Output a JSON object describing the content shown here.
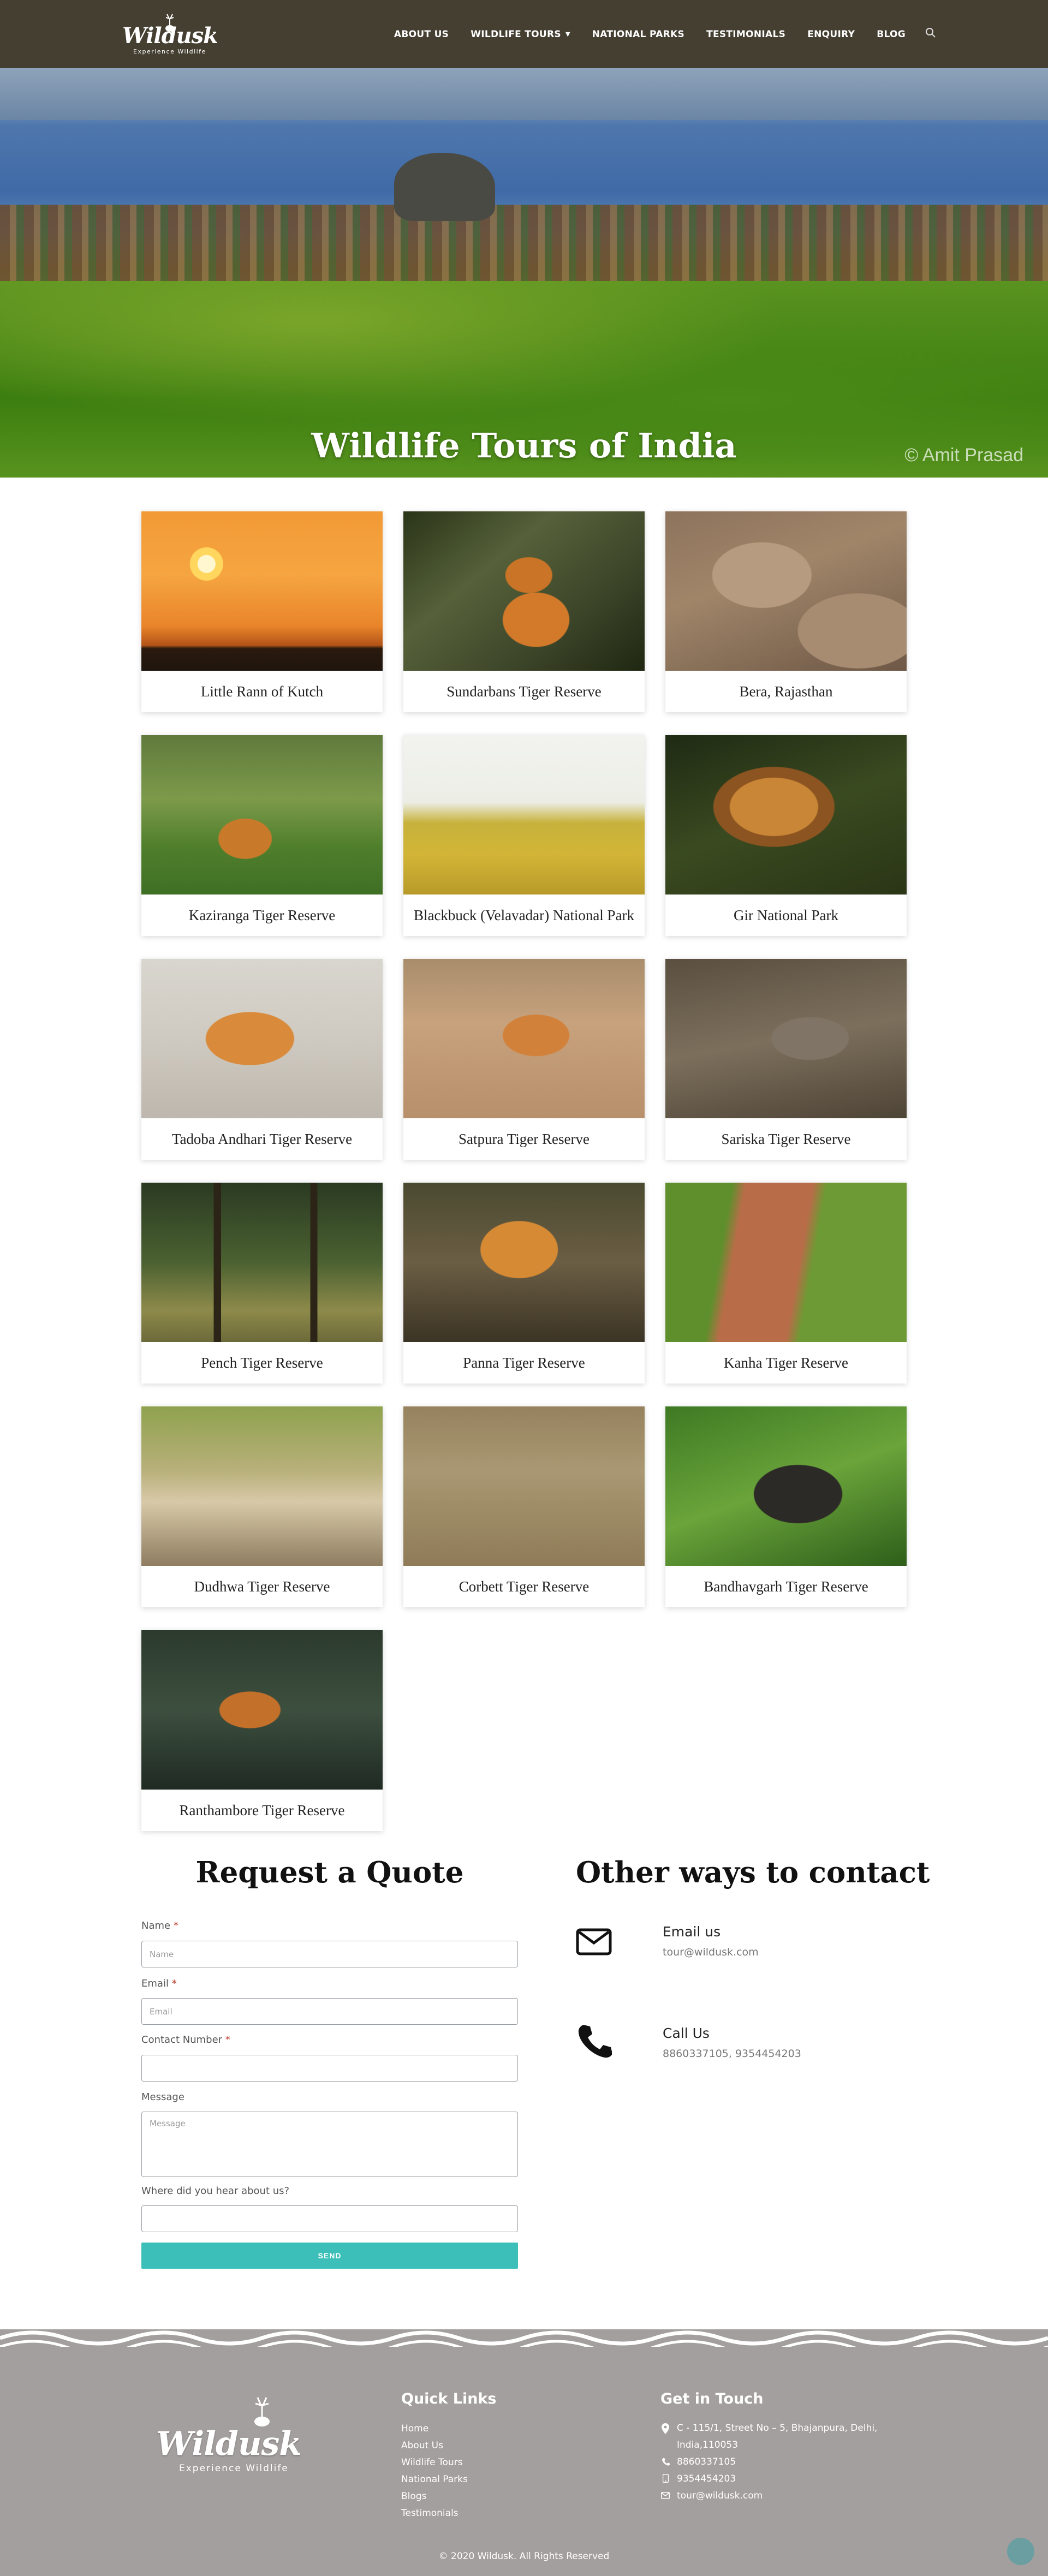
{
  "brand": {
    "logo_text": "Wildusk",
    "logo_sub": "Experience Wildlife"
  },
  "nav": {
    "items": [
      "ABOUT US",
      "WILDLIFE TOURS",
      "NATIONAL PARKS",
      "TESTIMONIALS",
      "ENQUIRY",
      "BLOG"
    ],
    "search_icon": "search-icon"
  },
  "hero": {
    "title": "Wildlife Tours of India",
    "credit": "© Amit Prasad"
  },
  "tours": [
    {
      "name": "Little Rann of Kutch",
      "img": "sunset"
    },
    {
      "name": "Sundarbans Tiger Reserve",
      "img": "tiger-forest"
    },
    {
      "name": "Bera, Rajasthan",
      "img": "rocks"
    },
    {
      "name": "Kaziranga Tiger Reserve",
      "img": "tiger-grass"
    },
    {
      "name": "Blackbuck (Velavadar) National Park",
      "img": "blackbuck"
    },
    {
      "name": "Gir National Park",
      "img": "lion"
    },
    {
      "name": "Tadoba Andhari Tiger Reserve",
      "img": "tiger-light"
    },
    {
      "name": "Satpura Tiger Reserve",
      "img": "tiger-road"
    },
    {
      "name": "Sariska Tiger Reserve",
      "img": "hyena"
    },
    {
      "name": "Pench Tiger Reserve",
      "img": "forest-dark"
    },
    {
      "name": "Panna Tiger Reserve",
      "img": "tiger-rocks"
    },
    {
      "name": "Kanha Tiger Reserve",
      "img": "tiger-path"
    },
    {
      "name": "Dudhwa Tiger Reserve",
      "img": "tiger-resting"
    },
    {
      "name": "Corbett Tiger Reserve",
      "img": "tiger-cubs"
    },
    {
      "name": "Bandhavgarh Tiger Reserve",
      "img": "gaur"
    },
    {
      "name": "Ranthambore Tiger Reserve",
      "img": "tiger-water"
    }
  ],
  "quote": {
    "title": "Request a Quote",
    "name_label": "Name",
    "name_placeholder": "Name",
    "email_label": "Email",
    "email_placeholder": "Email",
    "contact_label": "Contact Number",
    "message_label": "Message",
    "message_placeholder": "Message",
    "hear_label": "Where did you hear about us?",
    "required_mark": "*",
    "send_label": "SEND"
  },
  "contact": {
    "title": "Other ways to contact",
    "email_head": "Email us",
    "email_value": "tour@wildusk.com",
    "call_head": "Call Us",
    "call_value": "8860337105, 9354454203"
  },
  "footer": {
    "quick_links_title": "Quick Links",
    "quick_links": [
      "Home",
      "About Us",
      "Wildlife Tours",
      "National Parks",
      "Blogs",
      "Testimonials"
    ],
    "get_in_touch_title": "Get in Touch",
    "address_line1": "C - 115/1, Street No – 5, Bhajanpura, Delhi,",
    "address_line2": "India,110053",
    "phone1": "8860337105",
    "phone2": "9354454203",
    "email": "tour@wildusk.com",
    "copyright": "© 2020 Wildusk. All Rights Reserved"
  }
}
